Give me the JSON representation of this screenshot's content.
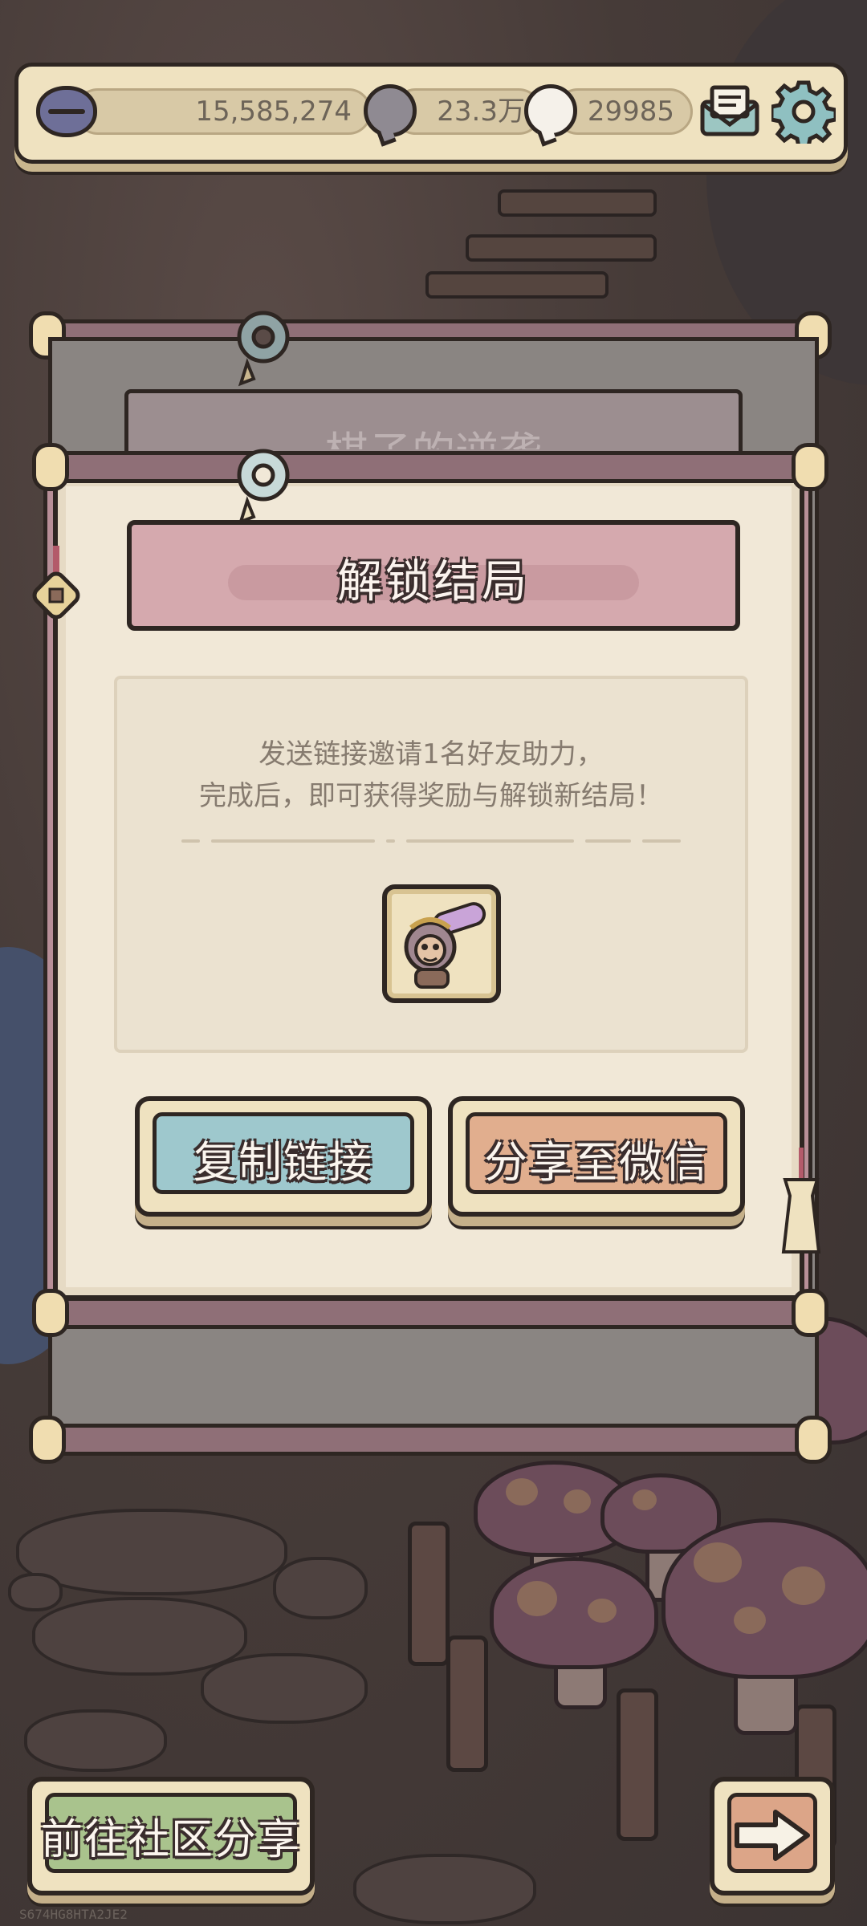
{
  "resources": {
    "coins": "15,585,274",
    "messages": "23.3万",
    "ghosts": "29985"
  },
  "dialog": {
    "back_title_fragment": "棋子的逆袭",
    "title": "解锁结局",
    "line1": "发送链接邀请1名好友助力，",
    "line2": "完成后，即可获得奖励与解锁新结局！",
    "copy_button": "复制链接",
    "share_button": "分享至微信"
  },
  "bottom": {
    "community_button": "前往社区分享",
    "uid": "S674HG8HTA2JE2"
  },
  "colors": {
    "panel": "#f1e8d7",
    "title_banner": "#d5a9ae",
    "copy_button": "#9ec8cd",
    "share_button": "#e1ae8e",
    "community_button": "#a9c38d",
    "outline": "#2e2622"
  }
}
